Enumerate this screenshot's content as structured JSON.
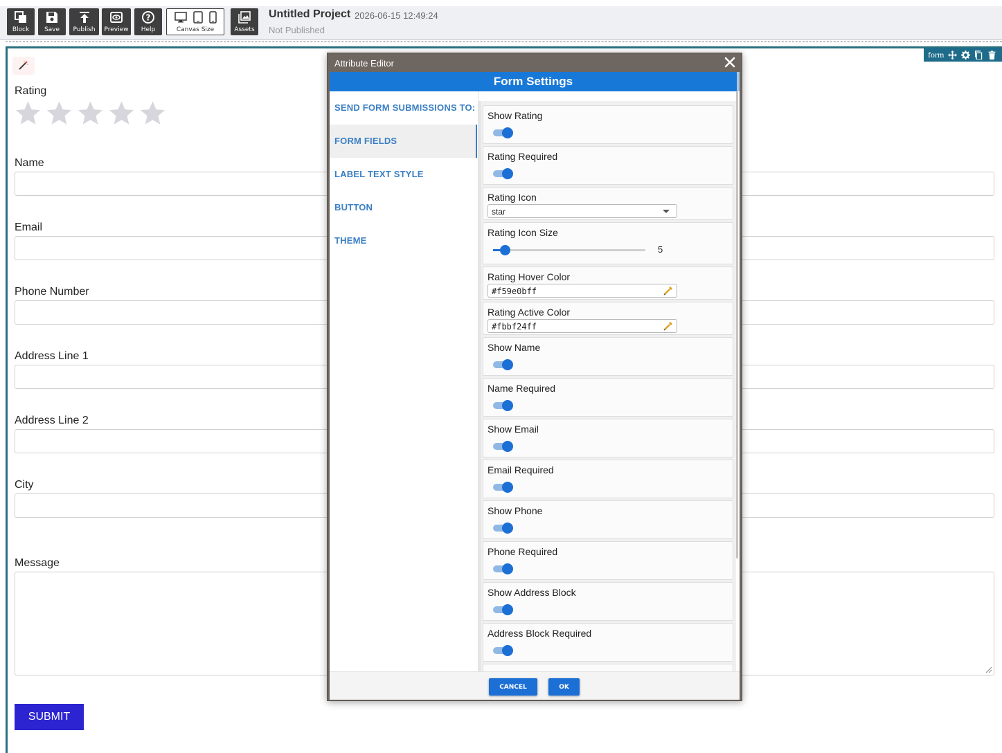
{
  "toolbar": {
    "block_label": "Block",
    "save_label": "Save",
    "publish_label": "Publish",
    "preview_label": "Preview",
    "help_label": "Help",
    "canvas_size_label": "Canvas Size",
    "assets_label": "Assets"
  },
  "project": {
    "title": "Untitled Project",
    "timestamp": "2026-06-15 12:49:24",
    "status": "Not Published"
  },
  "selection": {
    "tag": "form"
  },
  "form": {
    "rating_label": "Rating",
    "rating_stars": 5,
    "name_label": "Name",
    "email_label": "Email",
    "phone_label": "Phone Number",
    "address1_label": "Address Line 1",
    "address2_label": "Address Line 2",
    "city_label": "City",
    "message_label": "Message",
    "submit_label": "SUBMIT"
  },
  "modal": {
    "title": "Attribute Editor",
    "section_title": "Form Settings",
    "nav": [
      {
        "label": "SEND FORM SUBMISSIONS TO:"
      },
      {
        "label": "FORM FIELDS",
        "active": true
      },
      {
        "label": "LABEL TEXT STYLE"
      },
      {
        "label": "BUTTON"
      },
      {
        "label": "THEME"
      }
    ],
    "settings": {
      "show_rating": "Show Rating",
      "rating_required": "Rating Required",
      "rating_icon": "Rating Icon",
      "rating_icon_value": "star",
      "rating_icon_size": "Rating Icon Size",
      "rating_icon_size_value": "5",
      "rating_hover_color": "Rating Hover Color",
      "rating_hover_color_value": "#f59e0bff",
      "rating_active_color": "Rating Active Color",
      "rating_active_color_value": "#fbbf24ff",
      "show_name": "Show Name",
      "name_required": "Name Required",
      "show_email": "Show Email",
      "email_required": "Email Required",
      "show_phone": "Show Phone",
      "phone_required": "Phone Required",
      "show_address_block": "Show Address Block",
      "address_block_required": "Address Block Required"
    },
    "cancel_label": "CANCEL",
    "ok_label": "OK"
  },
  "colors": {
    "toolbar_button": "#3e3e3e",
    "modal_header": "#6e6660",
    "accent_blue": "#1878d8",
    "submit_button": "#2b24d0",
    "star_inactive": "#d6d6dc"
  }
}
